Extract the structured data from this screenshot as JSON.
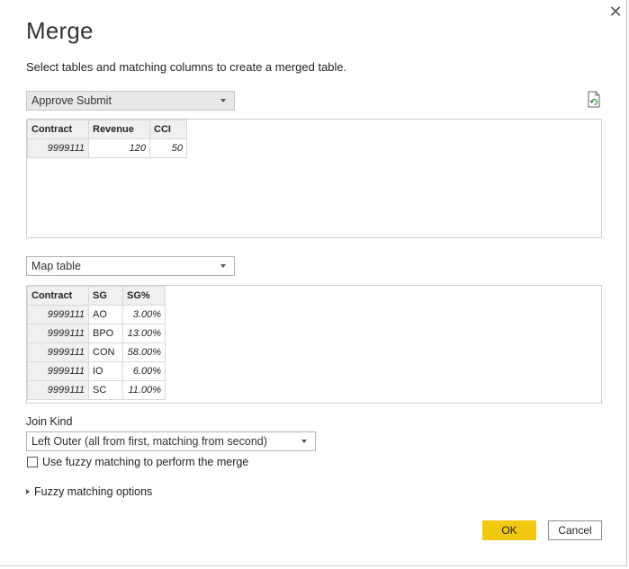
{
  "dialog": {
    "title": "Merge",
    "subtitle": "Select tables and matching columns to create a merged table.",
    "close_glyph": "✕"
  },
  "first_table": {
    "selected": "Approve Submit",
    "columns": [
      "Contract",
      "Revenue",
      "CCI"
    ],
    "rows": [
      [
        "9999111",
        "120",
        "50"
      ]
    ]
  },
  "second_table": {
    "selected": "Map table",
    "columns": [
      "Contract",
      "SG",
      "SG%"
    ],
    "rows": [
      [
        "9999111",
        "AO",
        "3.00%"
      ],
      [
        "9999111",
        "BPO",
        "13.00%"
      ],
      [
        "9999111",
        "CON",
        "58.00%"
      ],
      [
        "9999111",
        "IO",
        "6.00%"
      ],
      [
        "9999111",
        "SC",
        "11.00%"
      ]
    ]
  },
  "join": {
    "label": "Join Kind",
    "selected": "Left Outer (all from first, matching from second)"
  },
  "fuzzy": {
    "checkbox_label": "Use fuzzy matching to perform the merge",
    "checked": false,
    "options_label": "Fuzzy matching options"
  },
  "buttons": {
    "ok": "OK",
    "cancel": "Cancel"
  },
  "icons": {
    "refresh": "refresh-preview-icon",
    "close": "close-icon"
  },
  "colors": {
    "ok_button": "#f2c811",
    "header_bg": "#f0f0f0"
  }
}
